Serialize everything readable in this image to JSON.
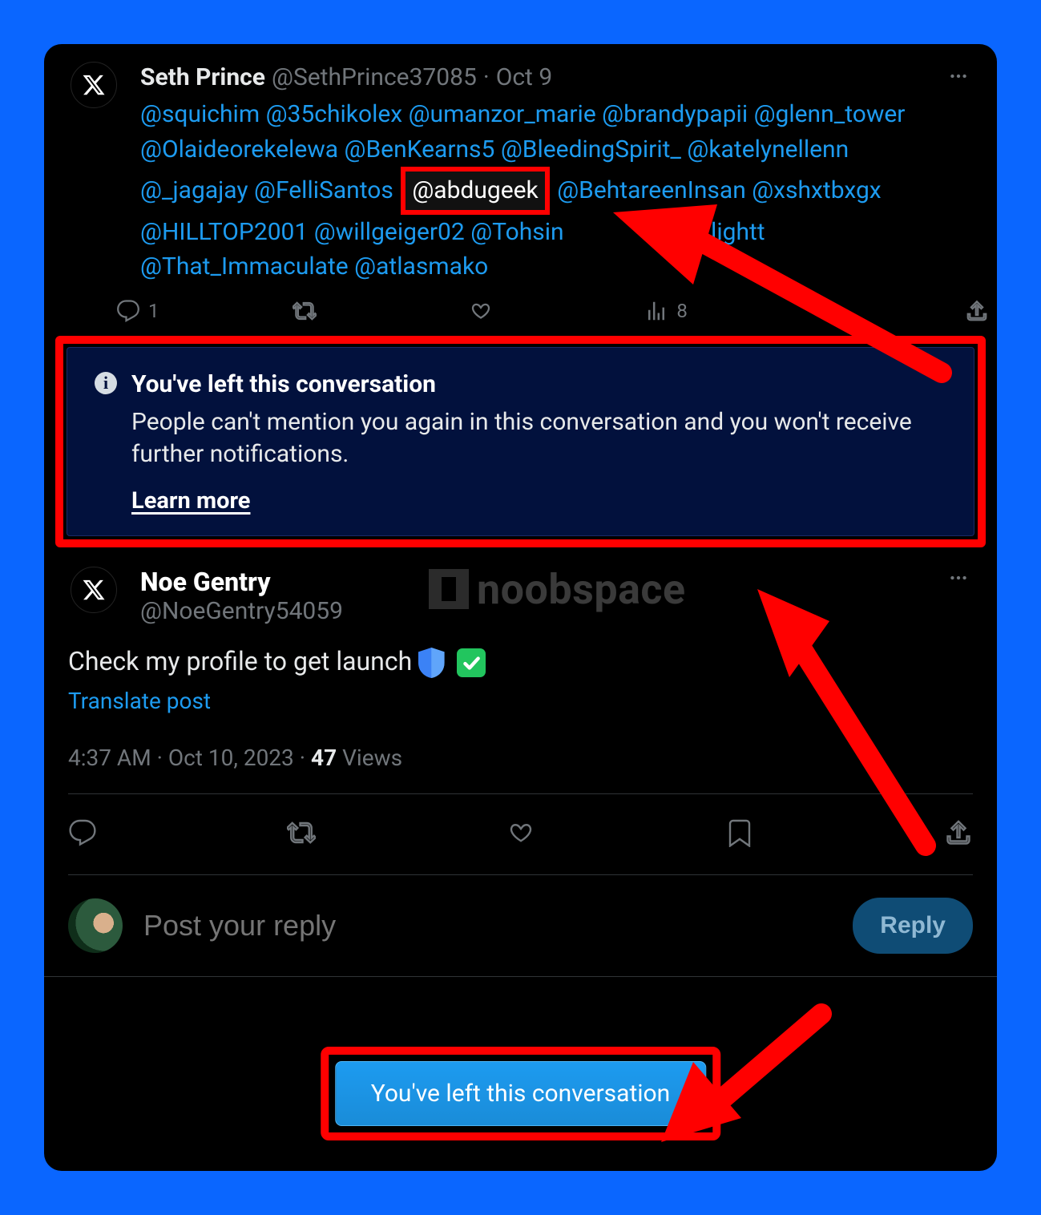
{
  "tweet1": {
    "author_name": "Seth Prince",
    "author_handle": "@SethPrince37085",
    "date": "Oct 9",
    "mentions_pre": "@squichim @35chikolex @umanzor_marie @brandypapii @glenn_tower @Olaideorekelewa @BenKearns5 @BleedingSpirit_ @katelynellenn @_jagajay @FelliSantos",
    "mention_boxed": "@abdugeek",
    "mentions_mid": "@BehtareenInsan @xshxtbxgx @HILLTOP2001 @willgeiger02 @Tohsin",
    "mentions_obscured_tail": "onxxlightt",
    "mentions_tail": "@That_Immaculate @atlasmako",
    "reply_count": "1",
    "views_count": "8"
  },
  "banner": {
    "title": "You've left this conversation",
    "desc": "People can't mention you again in this conversation and you won't receive further notifications.",
    "link": "Learn more"
  },
  "tweet2": {
    "author_name": "Noe Gentry",
    "author_handle": "@NoeGentry54059",
    "text": "Check my profile to get launch",
    "translate": "Translate post",
    "time": "4:37 AM",
    "date": "Oct 10, 2023",
    "views_number": "47",
    "views_label": "Views"
  },
  "watermark": {
    "text": "noobspace"
  },
  "composer": {
    "placeholder": "Post your reply",
    "reply_label": "Reply"
  },
  "toast": {
    "label": "You've left this conversation"
  }
}
